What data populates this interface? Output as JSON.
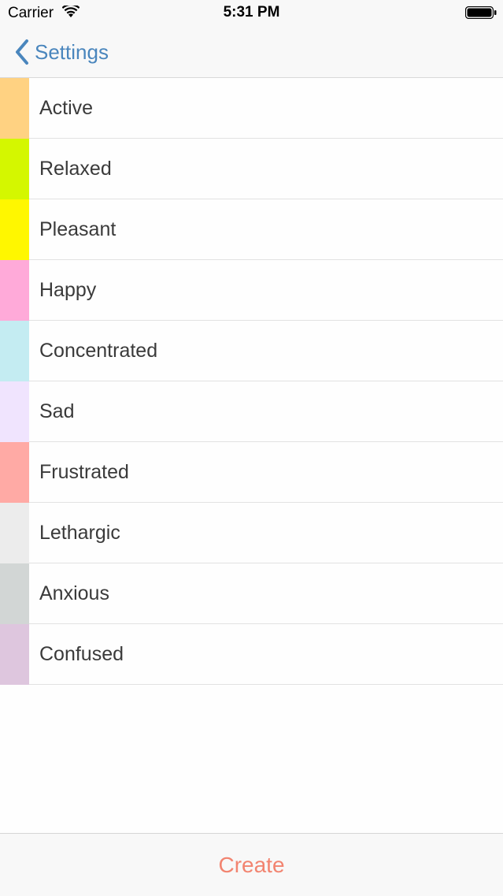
{
  "status_bar": {
    "carrier": "Carrier",
    "time": "5:31 PM",
    "icons": [
      "wifi-icon",
      "battery-icon"
    ]
  },
  "nav": {
    "back_label": "Settings",
    "back_icon": "chevron-left-icon",
    "accent_color": "#4a86bd"
  },
  "moods": [
    {
      "label": "Active",
      "color": "#ffd282"
    },
    {
      "label": "Relaxed",
      "color": "#d4f700"
    },
    {
      "label": "Pleasant",
      "color": "#fff700"
    },
    {
      "label": "Happy",
      "color": "#ffaad9"
    },
    {
      "label": "Concentrated",
      "color": "#c4ecf2"
    },
    {
      "label": "Sad",
      "color": "#f0e4fe"
    },
    {
      "label": "Frustrated",
      "color": "#ffaaa5"
    },
    {
      "label": "Lethargic",
      "color": "#ececec"
    },
    {
      "label": "Anxious",
      "color": "#d2d6d5"
    },
    {
      "label": "Confused",
      "color": "#dec6de"
    }
  ],
  "toolbar": {
    "create_label": "Create",
    "create_color": "#f28470"
  }
}
